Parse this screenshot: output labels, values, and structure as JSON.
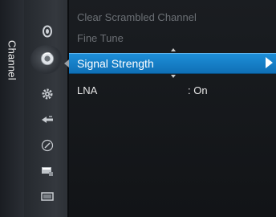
{
  "sidebar": {
    "tab_label": "Channel",
    "icons": [
      "picture-icon",
      "channel-icon",
      "setup-icon",
      "input-icon",
      "application-icon",
      "support-icon",
      "tv-icon"
    ],
    "active_icon": "channel-icon"
  },
  "menu": {
    "items": [
      {
        "label": "Clear Scrambled Channel",
        "state": "disabled"
      },
      {
        "label": "Fine Tune",
        "state": "disabled"
      },
      {
        "label": "Signal Strength",
        "state": "selected"
      },
      {
        "label": "LNA",
        "value": ": On",
        "state": "normal"
      }
    ]
  },
  "colors": {
    "highlight": "#1a87d0",
    "text": "#e8e8e8",
    "disabled_text": "#6b6f74",
    "background": "#15181c"
  }
}
